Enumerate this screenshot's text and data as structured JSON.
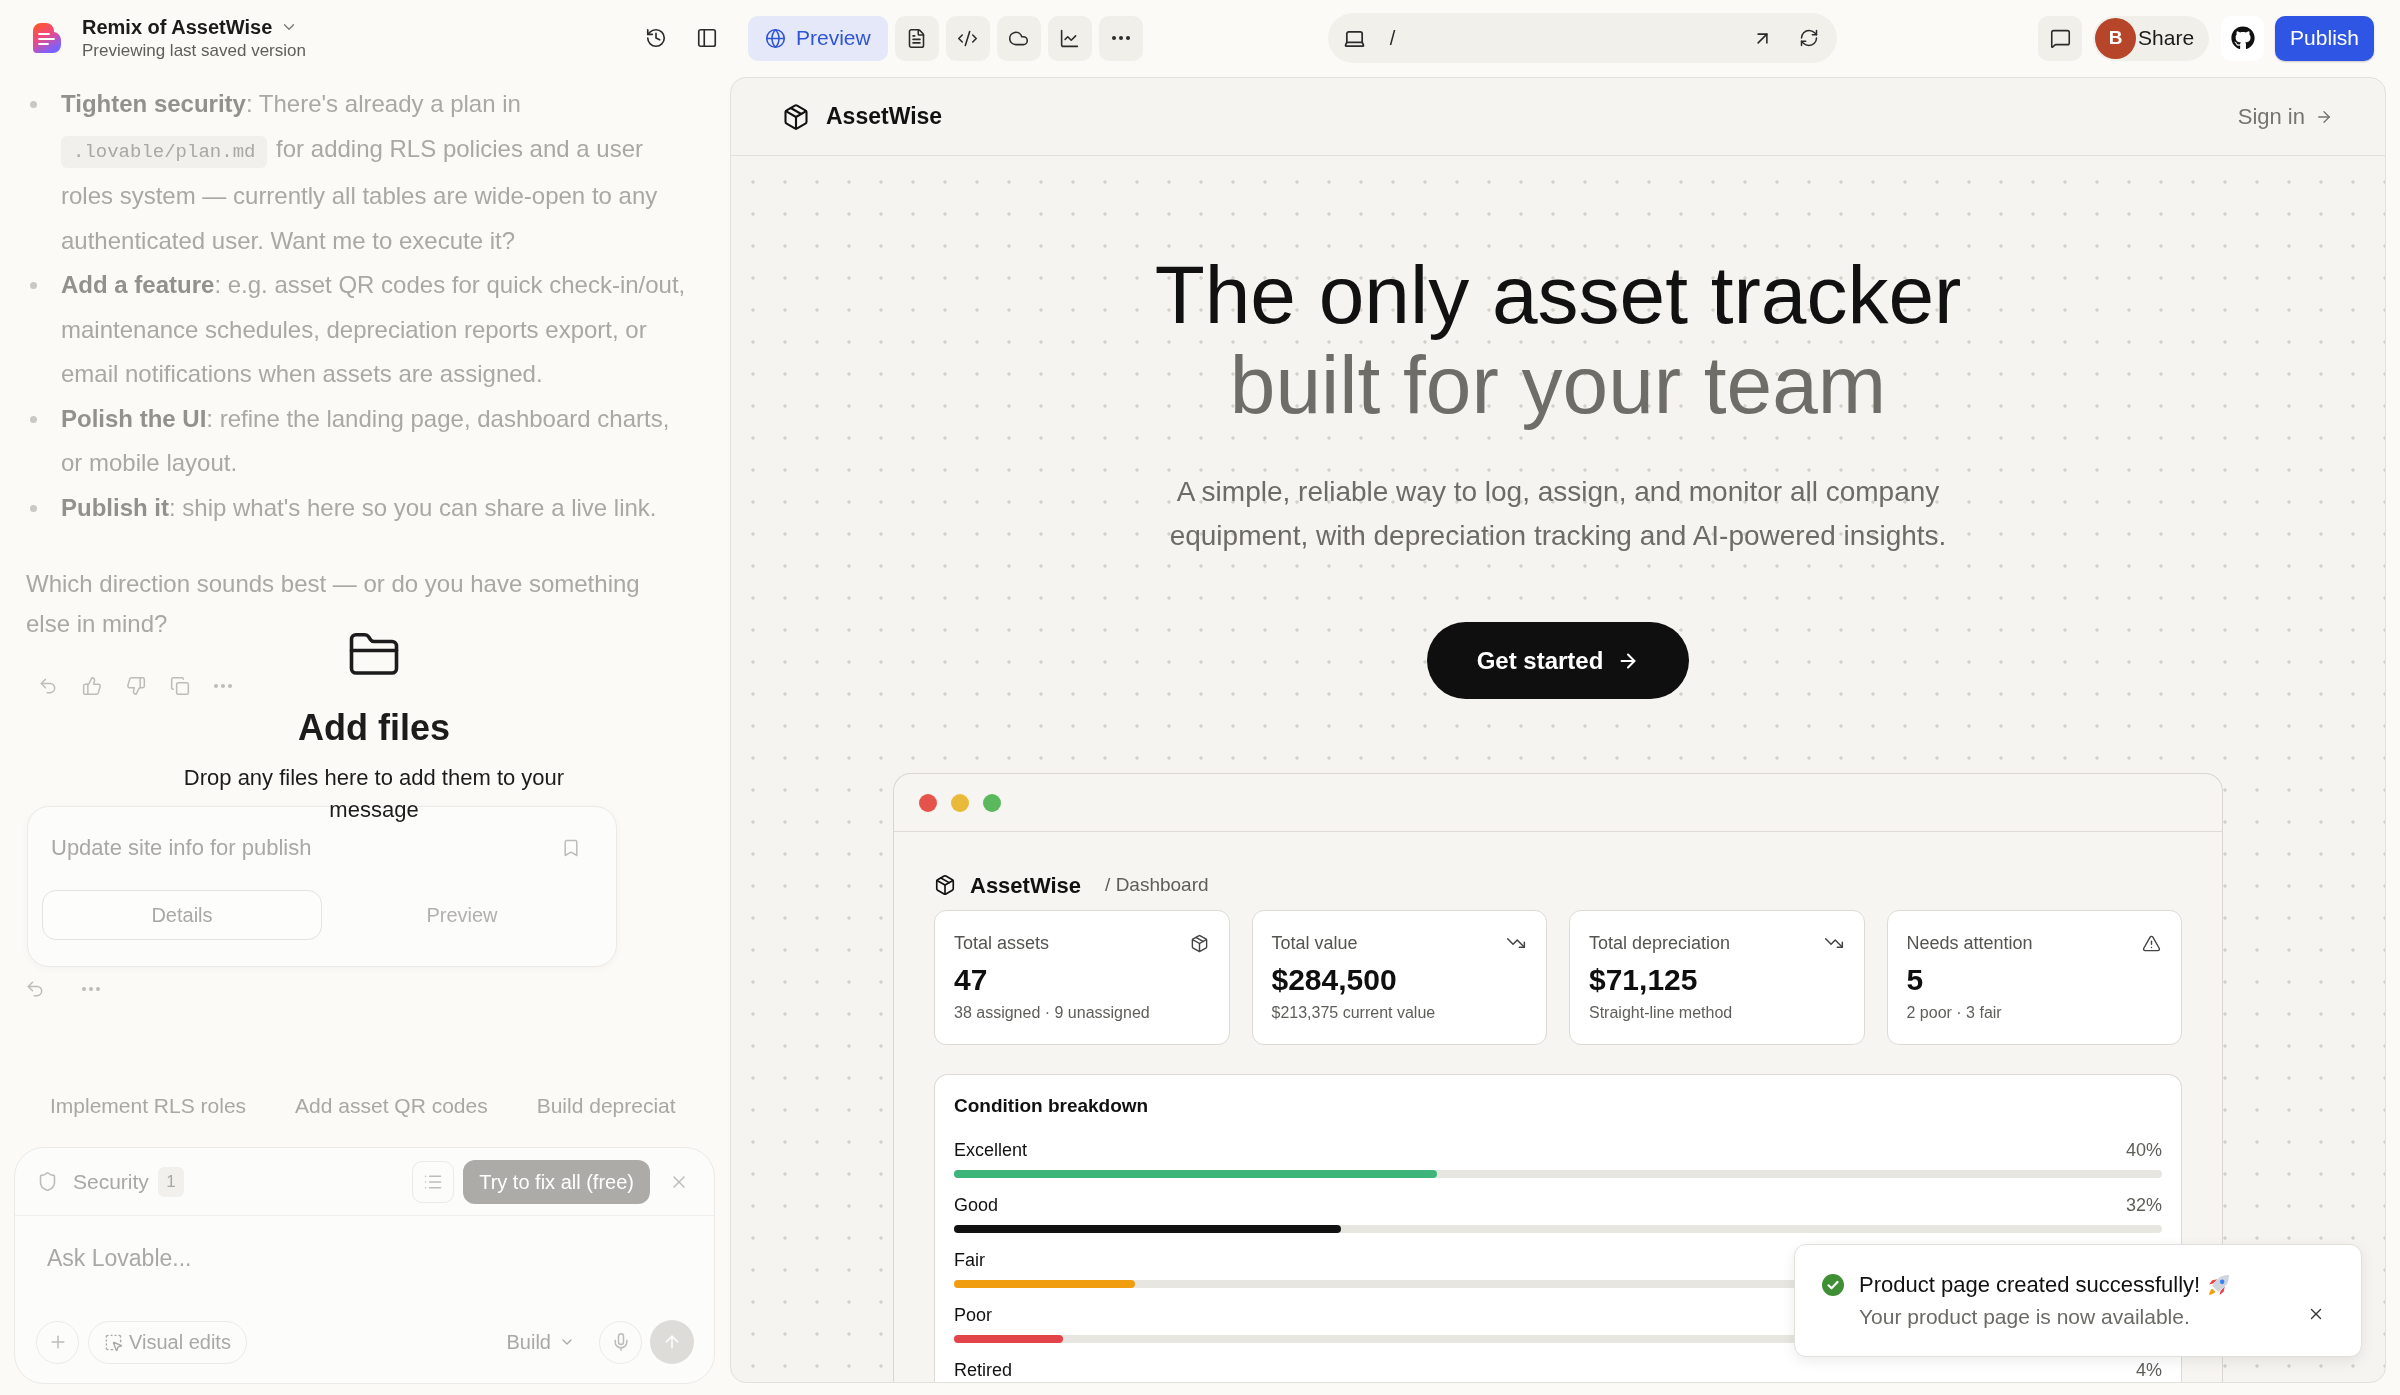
{
  "topbar": {
    "title": "Remix of AssetWise",
    "subtitle": "Previewing last saved version",
    "view_tabs": [
      {
        "kind": "preview",
        "label": "Preview",
        "selected": true
      },
      {
        "kind": "file",
        "selected": false
      },
      {
        "kind": "code",
        "selected": false
      },
      {
        "kind": "cloud",
        "selected": false
      },
      {
        "kind": "analytics",
        "selected": false
      },
      {
        "kind": "more",
        "selected": false
      }
    ],
    "url_path": "/",
    "avatar_initial": "B",
    "share_label": "Share",
    "publish_label": "Publish"
  },
  "chat": {
    "bullets": [
      {
        "parts": [
          {
            "kind": "text",
            "text": "**Tighten security**: There's already a plan in "
          },
          {
            "kind": "code",
            "text": ".lovable/plan.md"
          },
          {
            "kind": "text",
            "text": " for adding RLS policies and a user roles system — currently all tables are wide-open to any authenticated user. Want me to execute it?"
          }
        ]
      },
      {
        "parts": [
          {
            "kind": "text",
            "text": "**Add a feature**: e.g. asset QR codes for quick check-in/out, maintenance schedules, depreciation reports export, or email notifications when assets are assigned."
          }
        ]
      },
      {
        "parts": [
          {
            "kind": "text",
            "text": "**Polish the UI**: refine the landing page, dashboard charts, or mobile layout."
          }
        ]
      },
      {
        "parts": [
          {
            "kind": "text",
            "text": "**Publish it**: ship what's here so you can share a live link."
          }
        ]
      }
    ],
    "closing": "Which direction sounds best — or do you have something else in mind?",
    "task_card": {
      "title": "Update site info for publish",
      "tabs": [
        {
          "label": "Details",
          "selected": true
        },
        {
          "label": "Preview",
          "selected": false
        }
      ]
    },
    "suggestions": [
      "Implement RLS roles",
      "Add asset QR codes",
      "Build depreciat"
    ],
    "security": {
      "label": "Security",
      "count": "1",
      "fix_label": "Try to fix all (free)"
    },
    "composer": {
      "placeholder": "Ask Lovable...",
      "visual_edits": "Visual edits",
      "mode": "Build"
    },
    "drop_overlay": {
      "title": "Add files",
      "message": "Drop any files here to add them to your message"
    }
  },
  "preview": {
    "brand": "AssetWise",
    "sign_in": "Sign in",
    "headline": "The only asset tracker",
    "headline_muted": "built for your team",
    "description": "A simple, reliable way to log, assign, and monitor all company equipment, with depreciation tracking and AI-powered insights.",
    "cta": "Get started",
    "mockup": {
      "brand": "AssetWise",
      "breadcrumb": "/ Dashboard",
      "stats": [
        {
          "kind": "box",
          "label": "Total assets",
          "value": "47",
          "note": "38 assigned · 9 unassigned"
        },
        {
          "kind": "trend",
          "label": "Total value",
          "value": "$284,500",
          "note": "$213,375 current value"
        },
        {
          "kind": "trend",
          "label": "Total depreciation",
          "value": "$71,125",
          "note": "Straight-line method"
        },
        {
          "kind": "warning",
          "label": "Needs attention",
          "value": "5",
          "note": "2 poor · 3 fair"
        }
      ],
      "condition": {
        "title": "Condition breakdown",
        "rows": [
          {
            "label": "Excellent",
            "percent": "40%",
            "level": 0.4,
            "color": "#3cb47a"
          },
          {
            "label": "Good",
            "percent": "32%",
            "level": 0.32,
            "color": "#111111"
          },
          {
            "label": "Fair",
            "level": 0.15,
            "color": "#f09e10"
          },
          {
            "label": "Poor",
            "level": 0.09,
            "color": "#e3444a"
          },
          {
            "label": "Retired",
            "percent": "4%"
          }
        ]
      }
    },
    "toast": {
      "title": "Product page created successfully!",
      "message": "Your product page is now available."
    }
  }
}
